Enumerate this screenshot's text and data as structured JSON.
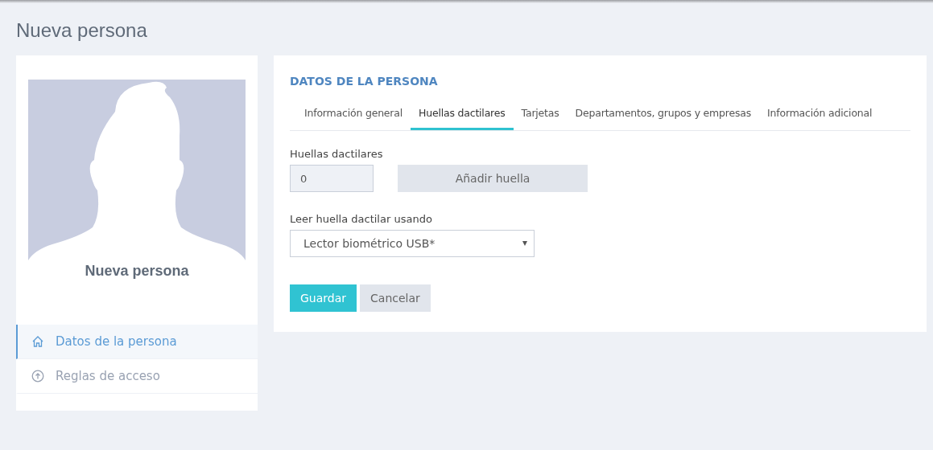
{
  "page_title": "Nueva persona",
  "profile": {
    "name": "Nueva persona"
  },
  "sidebar": {
    "items": [
      {
        "label": "Datos de la persona",
        "kind": "home",
        "selected": true
      },
      {
        "label": "Reglas de acceso",
        "kind": "up",
        "selected": false
      }
    ]
  },
  "panel": {
    "heading": "DATOS DE LA PERSONA",
    "tabs": [
      {
        "label": "Información general",
        "selected": false
      },
      {
        "label": "Huellas dactilares",
        "selected": true
      },
      {
        "label": "Tarjetas",
        "selected": false
      },
      {
        "label": "Departamentos, grupos y empresas",
        "selected": false
      },
      {
        "label": "Información adicional",
        "selected": false
      }
    ],
    "fingerprints": {
      "label": "Huellas dactilares",
      "value": "0",
      "add_button": "Añadir huella"
    },
    "reader": {
      "label": "Leer huella dactilar usando",
      "value": "Lector biométrico USB*"
    },
    "buttons": {
      "save": "Guardar",
      "cancel": "Cancelar"
    }
  }
}
